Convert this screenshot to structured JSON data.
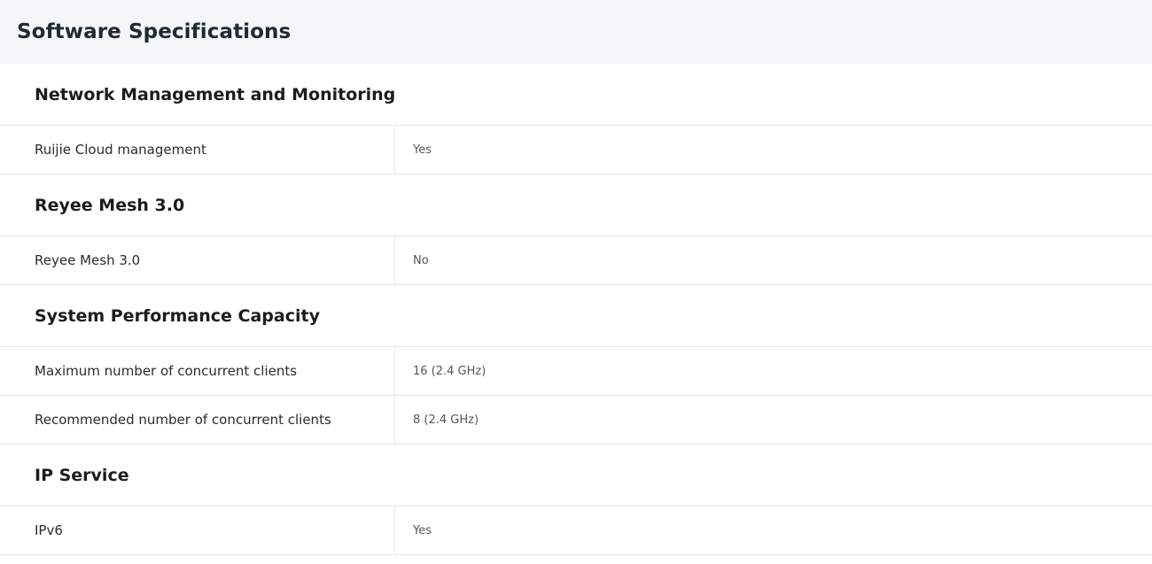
{
  "page": {
    "title": "Software Specifications"
  },
  "sections": [
    {
      "heading": "Network Management and Monitoring",
      "rows": [
        {
          "label": "Ruijie Cloud management",
          "value": "Yes"
        }
      ]
    },
    {
      "heading": "Reyee Mesh 3.0",
      "rows": [
        {
          "label": "Reyee Mesh 3.0",
          "value": "No"
        }
      ]
    },
    {
      "heading": "System Performance Capacity",
      "rows": [
        {
          "label": "Maximum number of concurrent clients",
          "value": "16 (2.4 GHz)"
        },
        {
          "label": "Recommended number of concurrent clients",
          "value": "8 (2.4 GHz)"
        }
      ]
    },
    {
      "heading": "IP Service",
      "rows": [
        {
          "label": "IPv6",
          "value": "Yes"
        }
      ]
    }
  ]
}
